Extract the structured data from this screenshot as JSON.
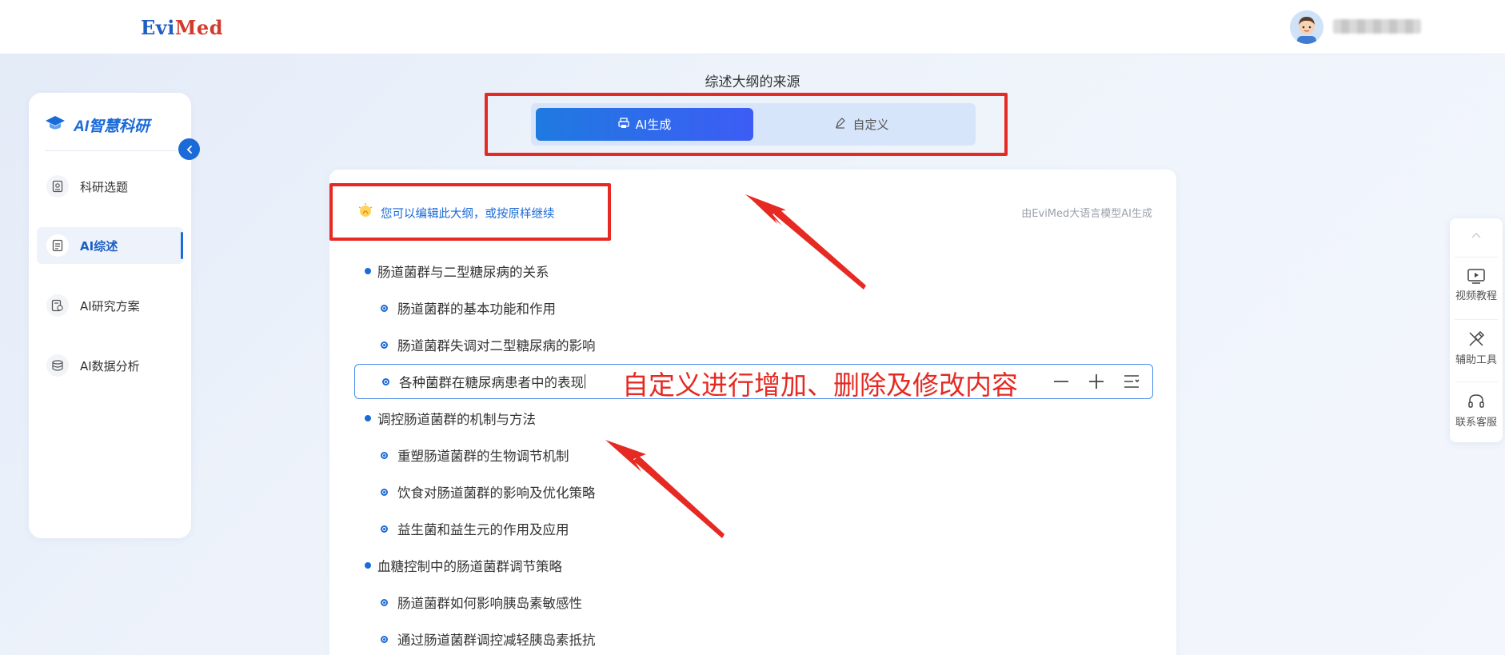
{
  "header": {
    "logo_part1": "Evi",
    "logo_part2": "Med"
  },
  "sidebar": {
    "brand": "AI智慧科研",
    "items": [
      {
        "label": "科研选题",
        "icon": "topic-icon",
        "active": false
      },
      {
        "label": "AI综述",
        "icon": "review-icon",
        "active": true
      },
      {
        "label": "AI研究方案",
        "icon": "plan-icon",
        "active": false
      },
      {
        "label": "AI数据分析",
        "icon": "data-icon",
        "active": false
      }
    ]
  },
  "source": {
    "title": "综述大纲的来源",
    "ai_label": "AI生成",
    "custom_label": "自定义"
  },
  "panel": {
    "hint": "您可以编辑此大纲，或按原样继续",
    "source_note": "由EviMed大语言模型AI生成",
    "outline": [
      {
        "level": 1,
        "text": "肠道菌群与二型糖尿病的关系"
      },
      {
        "level": 2,
        "text": "肠道菌群的基本功能和作用"
      },
      {
        "level": 2,
        "text": "肠道菌群失调对二型糖尿病的影响"
      },
      {
        "level": 2,
        "text": "各种菌群在糖尿病患者中的表现",
        "editing": true
      },
      {
        "level": 1,
        "text": "调控肠道菌群的机制与方法"
      },
      {
        "level": 2,
        "text": "重塑肠道菌群的生物调节机制"
      },
      {
        "level": 2,
        "text": "饮食对肠道菌群的影响及优化策略"
      },
      {
        "level": 2,
        "text": "益生菌和益生元的作用及应用"
      },
      {
        "level": 1,
        "text": "血糖控制中的肠道菌群调节策略"
      },
      {
        "level": 2,
        "text": "肠道菌群如何影响胰岛素敏感性"
      },
      {
        "level": 2,
        "text": "通过肠道菌群调控减轻胰岛素抵抗"
      }
    ]
  },
  "annotation": {
    "text": "自定义进行增加、删除及修改内容",
    "color": "#e62a23"
  },
  "floatbar": {
    "items": [
      {
        "label": "视频教程",
        "icon": "video-icon"
      },
      {
        "label": "辅助工具",
        "icon": "tools-icon"
      },
      {
        "label": "联系客服",
        "icon": "headset-icon"
      }
    ]
  },
  "colors": {
    "accent": "#1a6ad8",
    "annotation": "#e62a23"
  }
}
